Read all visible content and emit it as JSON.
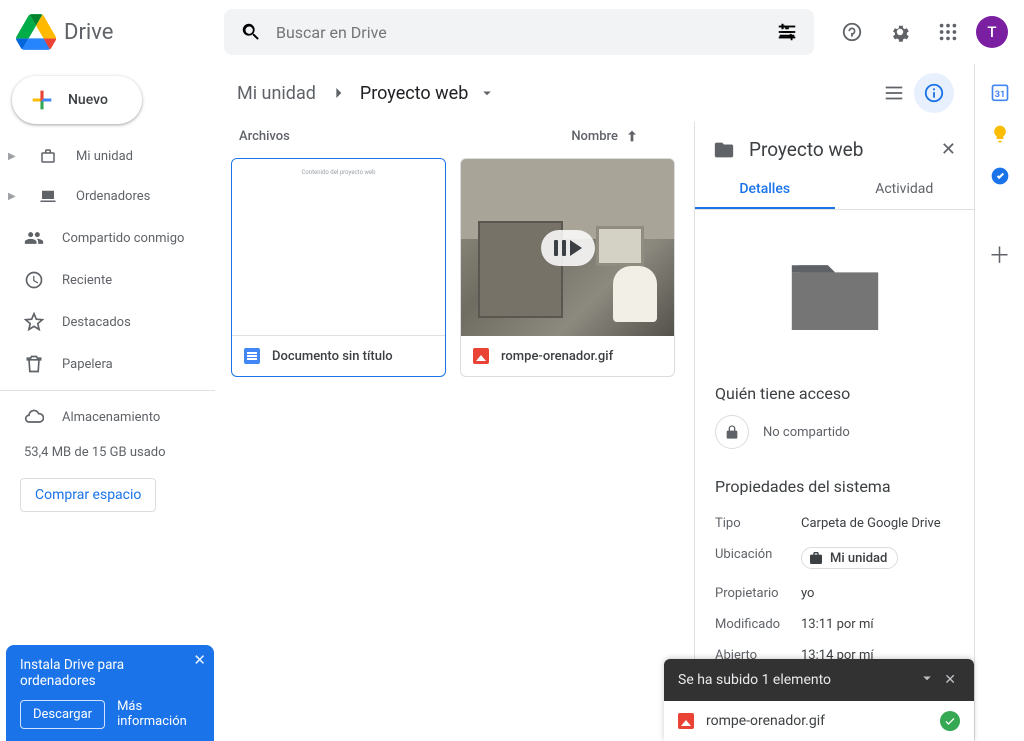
{
  "brand": "Drive",
  "search": {
    "placeholder": "Buscar en Drive"
  },
  "avatar_initial": "T",
  "sidebar": {
    "new_label": "Nuevo",
    "items": [
      {
        "label": "Mi unidad"
      },
      {
        "label": "Ordenadores"
      },
      {
        "label": "Compartido conmigo"
      },
      {
        "label": "Reciente"
      },
      {
        "label": "Destacados"
      },
      {
        "label": "Papelera"
      }
    ],
    "storage_label": "Almacenamiento",
    "storage_used": "53,4 MB de 15 GB usado",
    "buy_label": "Comprar espacio"
  },
  "breadcrumb": {
    "root": "Mi unidad",
    "current": "Proyecto web"
  },
  "files": {
    "section_label": "Archivos",
    "sort_label": "Nombre",
    "items": [
      {
        "name": "Documento sin título",
        "type": "doc",
        "preview_text": "Contenido del proyecto web"
      },
      {
        "name": "rompe-orenador.gif",
        "type": "img"
      }
    ]
  },
  "details": {
    "title": "Proyecto web",
    "tab_details": "Detalles",
    "tab_activity": "Actividad",
    "access_heading": "Quién tiene acceso",
    "access_status": "No compartido",
    "props_heading": "Propiedades del sistema",
    "props": {
      "type_k": "Tipo",
      "type_v": "Carpeta de Google Drive",
      "loc_k": "Ubicación",
      "loc_v": "Mi unidad",
      "owner_k": "Propietario",
      "owner_v": "yo",
      "mod_k": "Modificado",
      "mod_v": "13:11 por mí",
      "open_k": "Abierto",
      "open_v": "13:14 por mí"
    }
  },
  "upload_toast": {
    "title": "Se ha subido 1 elemento",
    "file": "rompe-orenador.gif"
  },
  "promo": {
    "title": "Instala Drive para ordenadores",
    "download": "Descargar",
    "more": "Más información"
  }
}
